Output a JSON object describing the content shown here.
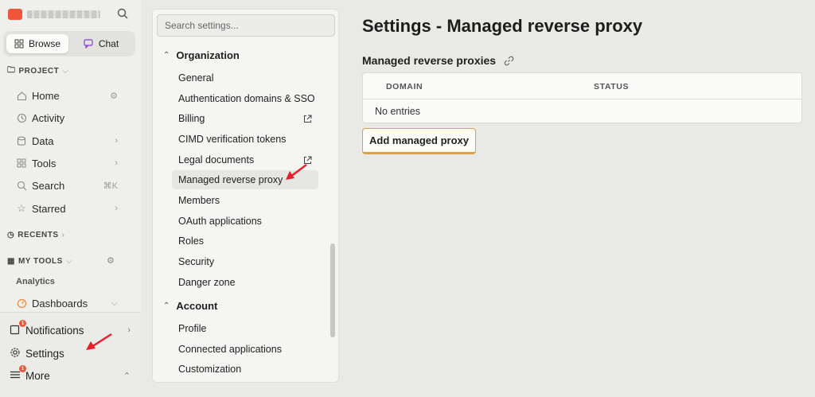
{
  "sidebar": {
    "modes": [
      {
        "label": "Browse",
        "active": true
      },
      {
        "label": "Chat",
        "active": false
      }
    ],
    "project_label": "PROJECT",
    "project_items": [
      {
        "label": "Home"
      },
      {
        "label": "Activity"
      },
      {
        "label": "Data"
      },
      {
        "label": "Tools"
      },
      {
        "label": "Search",
        "shortcut": "⌘K"
      },
      {
        "label": "Starred"
      }
    ],
    "recents_label": "RECENTS",
    "mytools_label": "MY TOOLS",
    "analytics_label": "Analytics",
    "dashboards_label": "Dashboards",
    "bottom": {
      "notifications_label": "Notifications",
      "notifications_badge": "1",
      "settings_label": "Settings",
      "more_label": "More",
      "more_badge": "1"
    }
  },
  "settings_nav": {
    "search_placeholder": "Search settings...",
    "groups": [
      {
        "label": "Organization",
        "items": [
          {
            "label": "General"
          },
          {
            "label": "Authentication domains & SSO"
          },
          {
            "label": "Billing",
            "external": true
          },
          {
            "label": "CIMD verification tokens"
          },
          {
            "label": "Legal documents",
            "external": true
          },
          {
            "label": "Managed reverse proxy",
            "selected": true
          },
          {
            "label": "Members"
          },
          {
            "label": "OAuth applications"
          },
          {
            "label": "Roles"
          },
          {
            "label": "Security"
          },
          {
            "label": "Danger zone"
          }
        ]
      },
      {
        "label": "Account",
        "items": [
          {
            "label": "Profile"
          },
          {
            "label": "Connected applications"
          },
          {
            "label": "Customization"
          }
        ]
      }
    ]
  },
  "main": {
    "page_title": "Settings - Managed reverse proxy",
    "section_title": "Managed reverse proxies",
    "table": {
      "columns": [
        "DOMAIN",
        "STATUS"
      ],
      "empty_text": "No entries"
    },
    "add_button_label": "Add managed proxy"
  },
  "colors": {
    "accent": "#f0553a",
    "button_border": "#d9a24a",
    "annotation_arrow": "#e8202a"
  }
}
